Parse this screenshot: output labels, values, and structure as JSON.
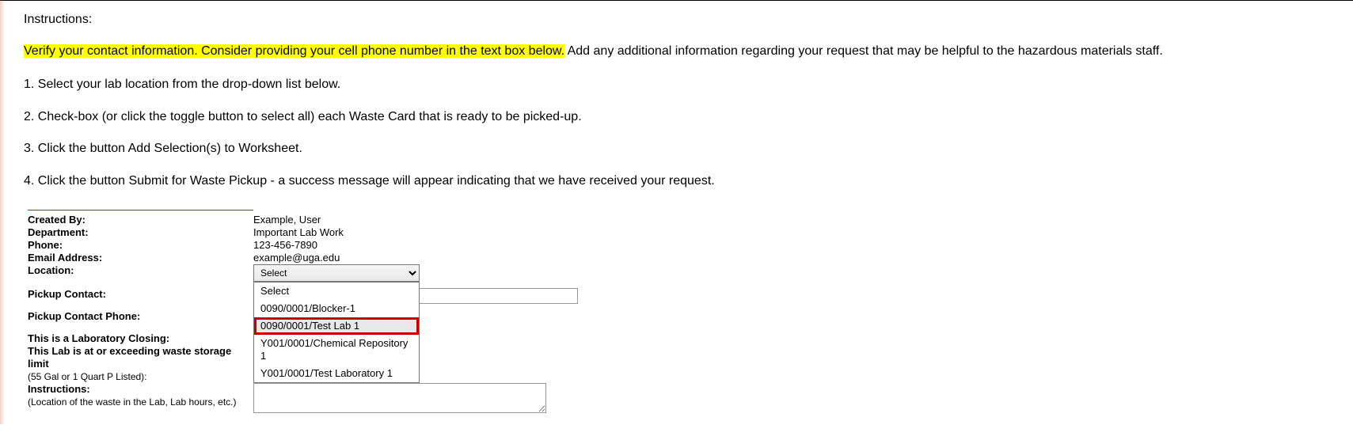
{
  "header": {
    "title": "Instructions:"
  },
  "intro": {
    "highlighted": "Verify your contact information.  Consider providing your cell phone number in the text box below.",
    "rest": " Add any additional information regarding your request that may be helpful to the hazardous materials staff."
  },
  "steps": {
    "s1": "1. Select your lab location from the drop-down list below.",
    "s2": "2. Check-box (or click the toggle button to select all) each Waste Card that is ready to be picked-up.",
    "s3": "3. Click the button Add Selection(s) to Worksheet.",
    "s4": "4. Click the button Submit for Waste Pickup - a success message will appear indicating that we have received your request."
  },
  "form": {
    "labels": {
      "created_by": "Created By:",
      "department": "Department:",
      "phone": "Phone:",
      "email": "Email Address:",
      "location": "Location:",
      "pickup_contact": "Pickup Contact:",
      "pickup_contact_phone": "Pickup Contact Phone:",
      "lab_closing": "This is a Laboratory Closing:",
      "storage_limit": "This Lab is at or exceeding waste storage limit",
      "storage_limit_sub": "(55 Gal or 1 Quart P Listed):",
      "instructions": "Instructions:",
      "instructions_sub": "(Location of the waste in the Lab, Lab hours, etc.)"
    },
    "values": {
      "created_by": "Example, User",
      "department": "Important Lab Work",
      "phone": "123-456-7890",
      "email": "example@uga.edu"
    },
    "location_select": {
      "selected": "Select",
      "options": {
        "o0": "Select",
        "o1": "0090/0001/Blocker-1",
        "o2": "0090/0001/Test Lab 1",
        "o3": "Y001/0001/Chemical Repository 1",
        "o4": "Y001/0001/Test Laboratory 1"
      }
    },
    "pickup_contact_value": "",
    "pickup_contact_phone_value": "",
    "instructions_value": ""
  }
}
